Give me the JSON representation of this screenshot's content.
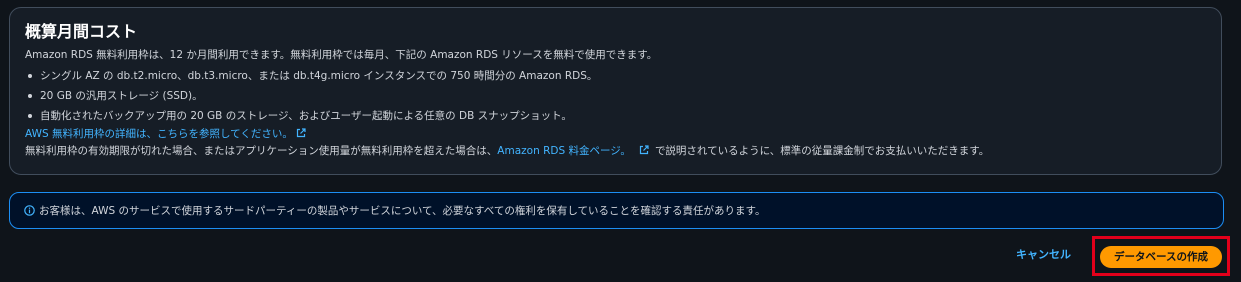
{
  "cost": {
    "title": "概算月間コスト",
    "intro": "Amazon RDS 無料利用枠は、12 か月間利用できます。無料利用枠では毎月、下記の Amazon RDS リソースを無料で使用できます。",
    "bullets": [
      "シングル AZ の db.t2.micro、db.t3.micro、または db.t4g.micro インスタンスでの 750 時間分の Amazon RDS。",
      "20 GB の汎用ストレージ (SSD)。",
      "自動化されたバックアップ用の 20 GB のストレージ、およびユーザー起動による任意の DB スナップショット。"
    ],
    "free_tier_link": "AWS 無料利用枠の詳細は、こちらを参照してください。",
    "expiry_prefix": "無料利用枠の有効期限が切れた場合、またはアプリケーション使用量が無料利用枠を超えた場合は、",
    "pricing_link": "Amazon RDS 料金ページ。",
    "expiry_suffix": "で説明されているように、標準の従量課金制でお支払いいただきます。"
  },
  "alert": {
    "text": "お客様は、AWS のサービスで使用するサードパーティーの製品やサービスについて、必要なすべての権利を保有していることを確認する責任があります。"
  },
  "actions": {
    "cancel_label": "キャンセル",
    "create_label": "データベースの作成"
  },
  "colors": {
    "background": "#0f141a",
    "panel": "#161d26",
    "link": "#42b4ff",
    "primary_button": "#ff9900",
    "info_border": "#1c8ef4",
    "highlight": "#e3001b"
  },
  "icons": {
    "external_link": "external-link-icon",
    "info": "info-icon"
  }
}
